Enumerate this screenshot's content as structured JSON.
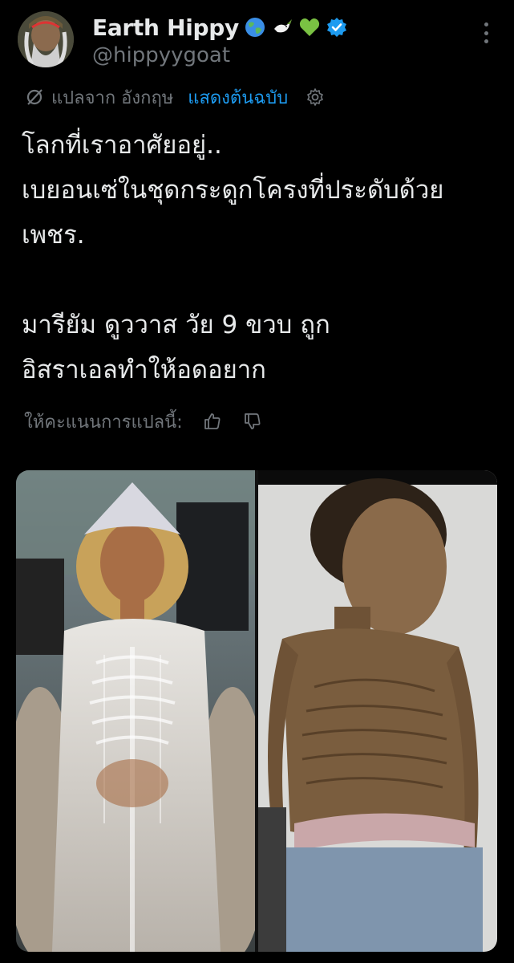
{
  "author": {
    "display_name": "Earth Hippy",
    "handle": "@hippyygoat",
    "badges": [
      "globe-emoji",
      "dove-emoji",
      "green-heart-emoji",
      "verified-badge"
    ],
    "verified_color": "#1d9bf0"
  },
  "translation": {
    "label": "แปลจาก อังกฤษ",
    "show_original": "แสดงต้นฉบับ",
    "icon": "no-translate-icon",
    "settings_icon": "gear-icon"
  },
  "tweet": {
    "text": "โลกที่เราอาศัยอยู่..\nเบยอนเซ่ในชุดกระดูกโครงที่ประดับด้วยเพชร.\n\nมารียัม ดูววาส วัย 9 ขวบ ถูก\nอิสราเอลทำให้อดอยาก"
  },
  "rating": {
    "label": "ให้คะแนนการแปลนี้:",
    "up_icon": "thumbs-up-icon",
    "down_icon": "thumbs-down-icon"
  },
  "media": {
    "photos": [
      {
        "name": "photo-left",
        "desc_icon": "photo"
      },
      {
        "name": "photo-right",
        "desc_icon": "photo"
      }
    ]
  },
  "colors": {
    "background": "#000000",
    "text": "#e7e9ea",
    "muted": "#71767b",
    "accent": "#1d9bf0"
  }
}
